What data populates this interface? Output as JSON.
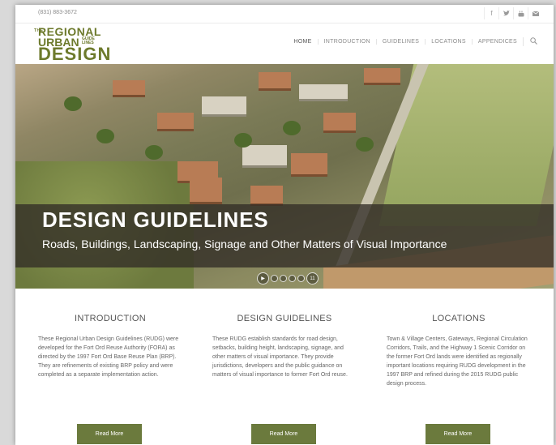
{
  "topbar": {
    "phone": "(831) 883-3672",
    "social": [
      "f",
      "t",
      "yt",
      "mail"
    ]
  },
  "logo": {
    "the": "THE",
    "line1": "REGIONAL",
    "line2": "URBAN",
    "guide": "GUIDE LINES",
    "line3": "DESIGN"
  },
  "nav": {
    "items": [
      "HOME",
      "INTRODUCTION",
      "GUIDELINES",
      "LOCATIONS",
      "APPENDICES"
    ],
    "search_icon": "search-icon"
  },
  "hero": {
    "title": "DESIGN GUIDELINES",
    "subtitle": "Roads, Buildings, Landscaping, Signage and Other Matters of Visual Importance",
    "slider": {
      "play": "▶",
      "counter": "11"
    }
  },
  "columns": [
    {
      "heading": "INTRODUCTION",
      "text": "These Regional Urban Design Guidelines (RUDG) were developed for the Fort Ord Reuse Authority (FORA) as directed by the 1997 Fort Ord Base Reuse Plan (BRP). They are refinements of existing BRP policy and were completed as a separate implementation action.",
      "button": "Read More"
    },
    {
      "heading": "DESIGN GUIDELINES",
      "text": "These RUDG establish standards for road design, setbacks, building height, landscaping, signage, and other matters of visual importance. They provide jurisdictions, developers and the public guidance on matters of visual importance to former Fort Ord reuse.",
      "button": "Read More"
    },
    {
      "heading": "LOCATIONS",
      "text": "Town & Village Centers, Gateways, Regional Circulation Corridors, Trails, and the Highway 1 Scenic Corridor on the former Fort Ord lands were identified as regionally important locations requiring RUDG development in the 1997 BRP and refined during the 2015 RUDG public design process.",
      "button": "Read More"
    }
  ],
  "colors": {
    "brand": "#6d7a2c",
    "button": "#6b7a3d"
  }
}
